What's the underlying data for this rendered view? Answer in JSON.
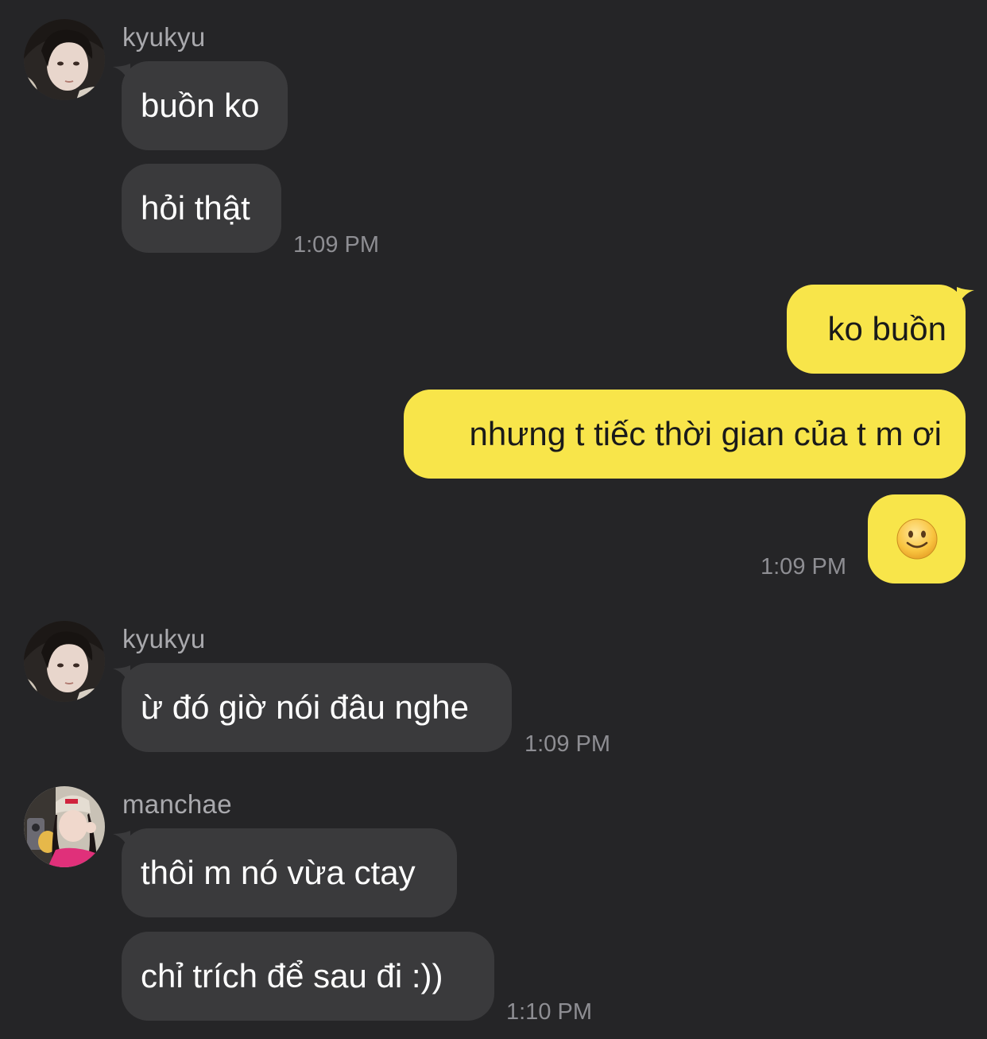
{
  "messages": [
    {
      "sender": "kyukyu",
      "direction": "in",
      "bubbles": [
        "buồn ko",
        "hỏi thật"
      ],
      "time": "1:09 PM"
    },
    {
      "sender": "",
      "direction": "out",
      "bubbles": [
        "ko buồn",
        "nhưng t tiếc thời gian của t m ơi",
        "slightly-smiling-face-emoji"
      ],
      "time": "1:09 PM"
    },
    {
      "sender": "kyukyu",
      "direction": "in",
      "bubbles": [
        "ừ đó giờ nói đâu nghe"
      ],
      "time": "1:09 PM"
    },
    {
      "sender": "manchae",
      "direction": "in",
      "bubbles": [
        "thôi m nó vừa ctay",
        "chỉ trích để sau đi :))"
      ],
      "time": "1:10 PM"
    }
  ],
  "colors": {
    "background": "#252527",
    "incoming_bubble": "#3a3a3c",
    "outgoing_bubble": "#f8e54a",
    "sender_name": "#a9a9ad",
    "timestamp": "#8e8e93"
  }
}
